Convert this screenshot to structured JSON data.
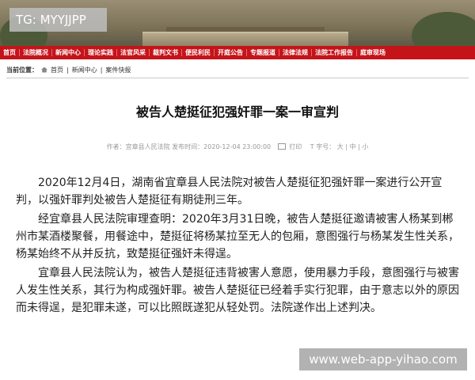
{
  "watermark_top": "TG: MYYJJPP",
  "watermark_bottom": "www.web-app-yihao.com",
  "nav": {
    "items": [
      "首页",
      "法院概况",
      "新闻中心",
      "理论实践",
      "法官风采",
      "裁判文书",
      "便民利民",
      "开庭公告",
      "专题报道",
      "法律法规",
      "法院工作报告",
      "庭审现场"
    ]
  },
  "breadcrumb": {
    "label": "当前位置：",
    "home": "首页",
    "section": "新闻中心",
    "page": "案件快报"
  },
  "article": {
    "title": "被告人楚挺征犯强奸罪一案一审宣判",
    "meta_author": "作者：宜章县人民法院  发布时间：2020-12-04 23:00:00",
    "print_label": "打印",
    "font_label": "字号：",
    "font_large": "大",
    "font_medium": "中",
    "font_small": "小",
    "paragraphs": [
      "2020年12月4日，湖南省宜章县人民法院对被告人楚挺征犯强奸罪一案进行公开宣判，以强奸罪判处被告人楚挺征有期徒刑三年。",
      "经宜章县人民法院审理查明：2020年3月31日晚，被告人楚挺征邀请被害人杨某到郴州市某酒楼聚餐，用餐途中，楚挺征将杨某拉至无人的包厢，意图强行与杨某发生性关系，杨某始终不从并反抗，致楚挺征强奸未得逞。",
      "宜章县人民法院认为，被告人楚挺征违背被害人意愿，使用暴力手段，意图强行与被害人发生性关系，其行为构成强奸罪。被告人楚挺征已经着手实行犯罪，由于意志以外的原因而未得逞，是犯罪未遂，可以比照既遂犯从轻处罚。法院遂作出上述判决。"
    ]
  },
  "colors": {
    "nav_bg": "#c4141a",
    "text": "#222222",
    "meta": "#999999"
  }
}
